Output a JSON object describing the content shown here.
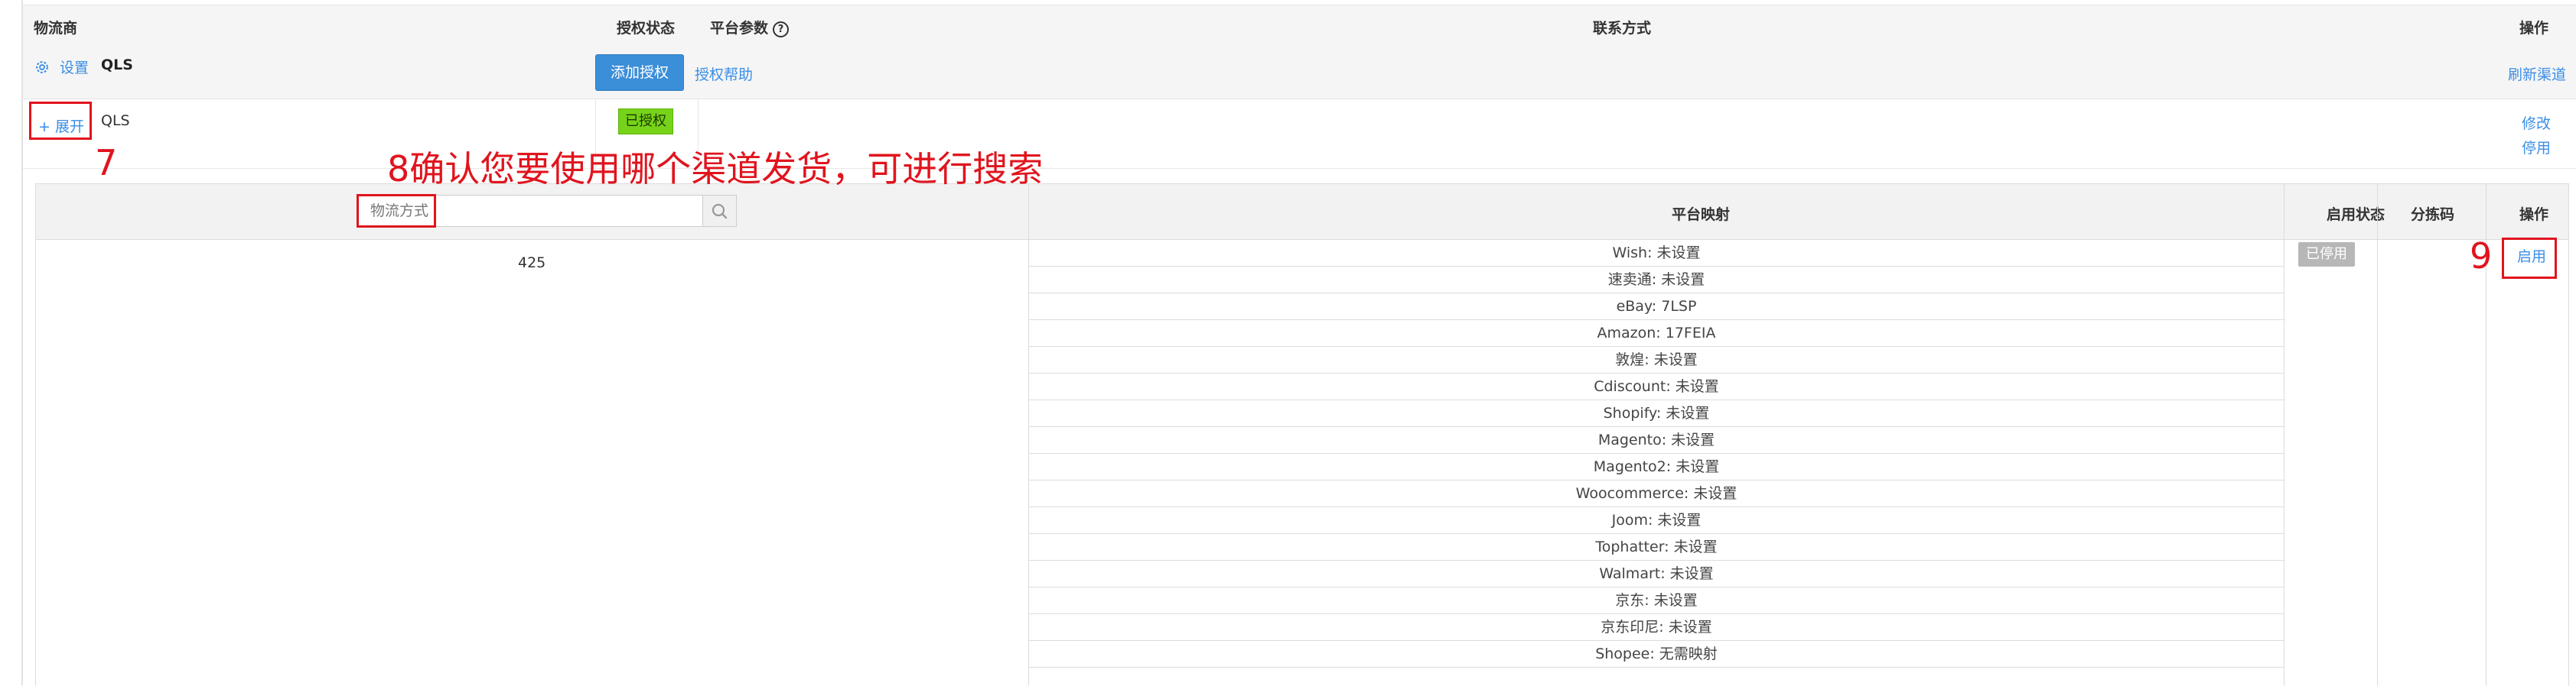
{
  "header": {
    "carrier": "物流商",
    "auth_status": "授权状态",
    "platform_params": "平台参数",
    "help_icon": "?",
    "contact": "联系方式",
    "actions": "操作"
  },
  "provider_row": {
    "settings_label": "设置",
    "provider_name": "QLS",
    "add_auth_label": "添加授权",
    "auth_help_label": "授权帮助",
    "refresh_channel_label": "刷新渠道"
  },
  "account_row": {
    "expand_label": "+ 展开",
    "account_name": "QLS",
    "status_badge": "已授权",
    "edit_label": "修改",
    "disable_label": "停用"
  },
  "channel_table": {
    "search_placeholder": "物流方式",
    "platform_mapping_header": "平台映射",
    "enable_status_header": "启用状态",
    "sort_code_header": "分拣码",
    "actions_header": "操作",
    "channel_code": "425",
    "status_badge": "已停用",
    "enable_label": "启用",
    "mappings": [
      "Wish:  未设置",
      "速卖通: 未设置",
      "eBay:  7LSP",
      "Amazon:  17FEIA",
      "敦煌:  未设置",
      "Cdiscount:  未设置",
      "Shopify:  未设置",
      "Magento:  未设置",
      "Magento2:  未设置",
      "Woocommerce:  未设置",
      "Joom:  未设置",
      "Tophatter:  未设置",
      "Walmart:  未设置",
      "京东:  未设置",
      "京东印尼:  未设置",
      "Shopee:  无需映射"
    ]
  },
  "annotations": {
    "step7": "7",
    "step8": "8确认您要使用哪个渠道发货，可进行搜索",
    "step9": "9"
  },
  "colors": {
    "primary_button": "#3b8ed8",
    "link": "#3a8ee6",
    "authorized_badge": "#77d21a",
    "disabled_badge": "#b7b7b7",
    "annotation": "#e0141e"
  }
}
